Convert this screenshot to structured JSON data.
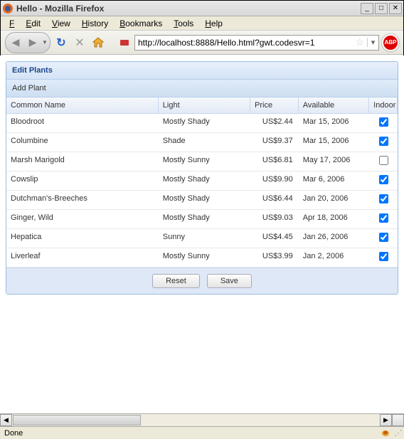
{
  "window": {
    "title": "Hello - Mozilla Firefox"
  },
  "menu": {
    "file": "File",
    "edit": "Edit",
    "view": "View",
    "history": "History",
    "bookmarks": "Bookmarks",
    "tools": "Tools",
    "help": "Help"
  },
  "toolbar": {
    "url": "http://localhost:8888/Hello.html?gwt.codesvr=1",
    "abp_label": "ABP"
  },
  "panel": {
    "title": "Edit Plants",
    "add_label": "Add Plant",
    "reset_label": "Reset",
    "save_label": "Save"
  },
  "columns": {
    "name": "Common Name",
    "light": "Light",
    "price": "Price",
    "available": "Available",
    "indoor": "Indoor"
  },
  "rows": [
    {
      "name": "Bloodroot",
      "light": "Mostly Shady",
      "price": "US$2.44",
      "available": "Mar 15, 2006",
      "indoor": true
    },
    {
      "name": "Columbine",
      "light": "Shade",
      "price": "US$9.37",
      "available": "Mar 15, 2006",
      "indoor": true
    },
    {
      "name": "Marsh Marigold",
      "light": "Mostly Sunny",
      "price": "US$6.81",
      "available": "May 17, 2006",
      "indoor": false
    },
    {
      "name": "Cowslip",
      "light": "Mostly Shady",
      "price": "US$9.90",
      "available": "Mar 6, 2006",
      "indoor": true
    },
    {
      "name": "Dutchman's-Breeches",
      "light": "Mostly Shady",
      "price": "US$6.44",
      "available": "Jan 20, 2006",
      "indoor": true
    },
    {
      "name": "Ginger, Wild",
      "light": "Mostly Shady",
      "price": "US$9.03",
      "available": "Apr 18, 2006",
      "indoor": true
    },
    {
      "name": "Hepatica",
      "light": "Sunny",
      "price": "US$4.45",
      "available": "Jan 26, 2006",
      "indoor": true
    },
    {
      "name": "Liverleaf",
      "light": "Mostly Sunny",
      "price": "US$3.99",
      "available": "Jan 2, 2006",
      "indoor": true
    }
  ],
  "status": {
    "text": "Done"
  }
}
